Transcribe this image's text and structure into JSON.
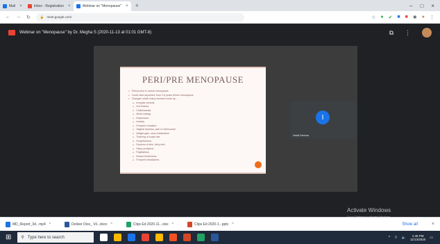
{
  "browser": {
    "tabs": [
      {
        "label": "Mail",
        "favicon_color": "#1a73e8"
      },
      {
        "label": "Inbox - Registration",
        "favicon_color": "#ea4335"
      },
      {
        "label": "Webinar on \"Menopause\"",
        "favicon_color": "#1a73e8"
      }
    ],
    "new_tab_label": "+",
    "window_controls": [
      "–",
      "□",
      "×"
    ],
    "address_url": "meet.google.com/"
  },
  "meet": {
    "title": "Webinar on \"Menopause\" by Dr. Megha S (2020-11-13 at 01:01 GMT-8)"
  },
  "slide": {
    "title": "PERI/PRE MENOPAUSE",
    "bullets": [
      {
        "text": "Period prior to actual menopause",
        "sub": false
      },
      {
        "text": "Could start anywhere from 2-8 years before menopause",
        "sub": false
      },
      {
        "text": "Changes which many woman's ends up ...",
        "sub": false
      },
      {
        "text": "Irregular periods",
        "sub": true
      },
      {
        "text": "Hot flushes",
        "sub": true
      },
      {
        "text": "Chills/sweats",
        "sub": true
      },
      {
        "text": "Mood swings",
        "sub": true
      },
      {
        "text": "Depression",
        "sub": true
      },
      {
        "text": "Anxiety",
        "sub": true
      },
      {
        "text": "Frequent urination",
        "sub": true
      },
      {
        "text": "Vaginal dryness, pain in intercourse",
        "sub": true
      },
      {
        "text": "Weight gain, slow metabolism",
        "sub": true
      },
      {
        "text": "Thinning of scalp hair",
        "sub": true
      },
      {
        "text": "Forgetfulness",
        "sub": true
      },
      {
        "text": "Dryness of skin, itchy skin",
        "sub": true
      },
      {
        "text": "Sleep problems",
        "sub": true
      },
      {
        "text": "Palpitations",
        "sub": true
      },
      {
        "text": "Breast tenderness",
        "sub": true
      },
      {
        "text": "Frequent headaches",
        "sub": true
      }
    ]
  },
  "participant": {
    "initial": "I",
    "name": "Install Seminar"
  },
  "watermark": {
    "title": "Activate Windows",
    "subtitle": "Go to Settings to activate Windows."
  },
  "downloads": {
    "items": [
      {
        "label": "MD_Report_3d...mp4",
        "icon_color": "#1a73e8"
      },
      {
        "label": "Deliver Dice_ Vil...docx",
        "icon_color": "#2b579a"
      },
      {
        "label": "Clips Ed 2020-11...xlsx",
        "icon_color": "#21a366"
      },
      {
        "label": "Clips Ed 2020-1...pptx",
        "icon_color": "#d24726"
      }
    ],
    "show_all": "Show all"
  },
  "taskbar": {
    "search_placeholder": "Type here to search",
    "apps": [
      "#ffffff",
      "#ffb900",
      "#1a73e8",
      "#ea4335",
      "#ffb900",
      "#f25022",
      "#d24726",
      "#21a366",
      "#2b579a"
    ],
    "time": "1:46 PM",
    "date": "11/13/2020"
  }
}
